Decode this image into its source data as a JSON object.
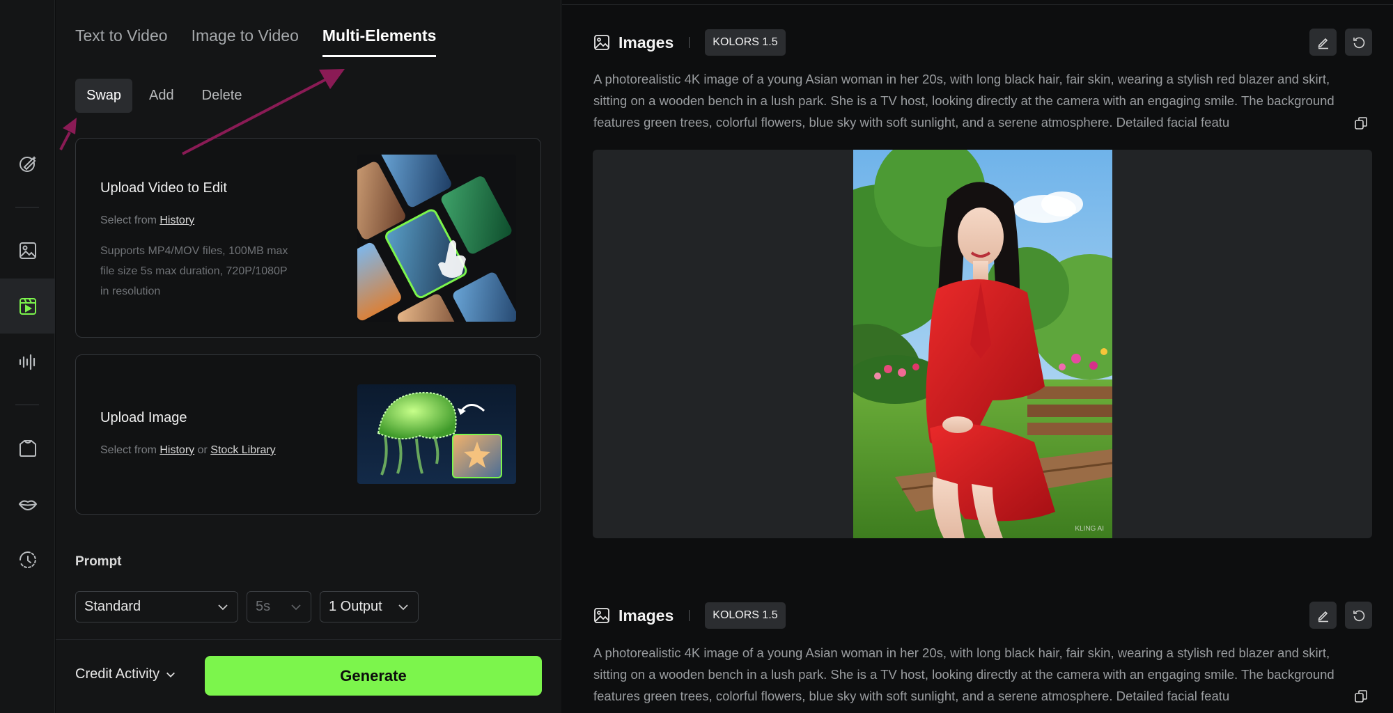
{
  "tabs": [
    {
      "label": "Text to Video"
    },
    {
      "label": "Image to Video"
    },
    {
      "label": "Multi-Elements"
    }
  ],
  "subtabs": [
    {
      "label": "Swap"
    },
    {
      "label": "Add"
    },
    {
      "label": "Delete"
    }
  ],
  "upload_video": {
    "title": "Upload Video to Edit",
    "select_prefix": "Select from",
    "history_link": "History",
    "desc_line1": "Supports MP4/MOV files, 100MB max",
    "desc_line2": "file size 5s max duration, 720P/1080P",
    "desc_line3": "in resolution"
  },
  "upload_image": {
    "title": "Upload Image",
    "select_prefix": "Select from",
    "history_link": "History",
    "or": "or",
    "stock_link": "Stock Library"
  },
  "prompt_label": "Prompt",
  "selects": {
    "mode": "Standard",
    "duration": "5s",
    "outputs": "1 Output"
  },
  "bottom": {
    "credit": "Credit Activity",
    "generate": "Generate"
  },
  "results": [
    {
      "title": "Images",
      "model": "KOLORS 1.5",
      "prompt": "A photorealistic 4K image of a young Asian woman in her 20s, with long black hair, fair skin, wearing a stylish red blazer and skirt, sitting on a wooden bench in a lush park. She is a TV host, looking directly at the camera with an engaging smile. The background features green trees, colorful flowers, blue sky with soft sunlight, and a serene atmosphere. Detailed facial featu",
      "watermark": "KLING AI"
    },
    {
      "title": "Images",
      "model": "KOLORS 1.5",
      "prompt": "A photorealistic 4K image of a young Asian woman in her 20s, with long black hair, fair skin, wearing a stylish red blazer and skirt, sitting on a wooden bench in a lush park. She is a TV host, looking directly at the camera with an engaging smile. The background features green trees, colorful flowers, blue sky with soft sunlight, and a serene atmosphere. Detailed facial featu"
    }
  ],
  "colors": {
    "accent": "#7cf54c",
    "annotation_arrow": "#8a1b55",
    "active_rail_icon": "#7cf54c"
  },
  "rail_icons": [
    "magic-pen-icon",
    "image-icon",
    "video-icon",
    "audio-wave-icon",
    "shirt-icon",
    "lips-icon",
    "history-icon"
  ]
}
